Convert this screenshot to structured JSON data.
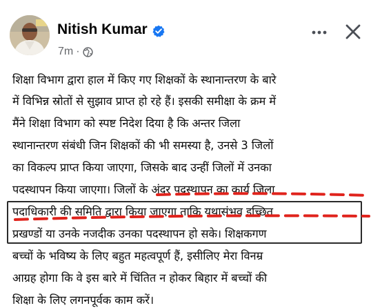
{
  "post": {
    "author_name": "Nitish Kumar",
    "timestamp": "7m",
    "separator": "·",
    "icons": {
      "verified": "verified-badge-icon",
      "audience": "globe-icon",
      "more": "more-options-icon",
      "close": "close-icon"
    },
    "colors": {
      "verified_blue": "#1877f2",
      "annotation_red": "#e0231c",
      "meta_grey": "#65676b"
    },
    "body_lines": [
      "शिक्षा विभाग द्वारा हाल में किए गए शिक्षकों के स्थानान्तरण के बारे",
      "में विभिन्न स्रोतों से सुझाव प्राप्त हो रहे हैं। इसकी समीक्षा के क्रम में",
      "मैंने शिक्षा विभाग को स्पष्ट निदेश दिया है कि अन्तर जिला",
      "स्थानान्तरण संबंधी जिन शिक्षकों की भी समस्या है, उनसे 3 जिलों",
      "का विकल्प प्राप्त किया जाएगा, जिसके बाद उन्हीं जिलों में उनका",
      "पदस्थापन किया जाएगा। जिलों के अंदर पदस्थापन का कार्य जिला",
      "पदाधिकारी की समिति द्वारा किया जाएगा ताकि यथासंभव इच्छित",
      "प्रखण्डों या उनके नजदीक उनका पदस्थापन हो सके। शिक्षकगण",
      "बच्चों के भविष्य के लिए बहुत महत्वपूर्ण हैं, इसीलिए मेरा विनम्र",
      "आग्रह होगा कि वे इस बारे में चिंतित न होकर बिहार में बच्चों की",
      "शिक्षा के लिए लगनपूर्वक काम करें।"
    ]
  }
}
